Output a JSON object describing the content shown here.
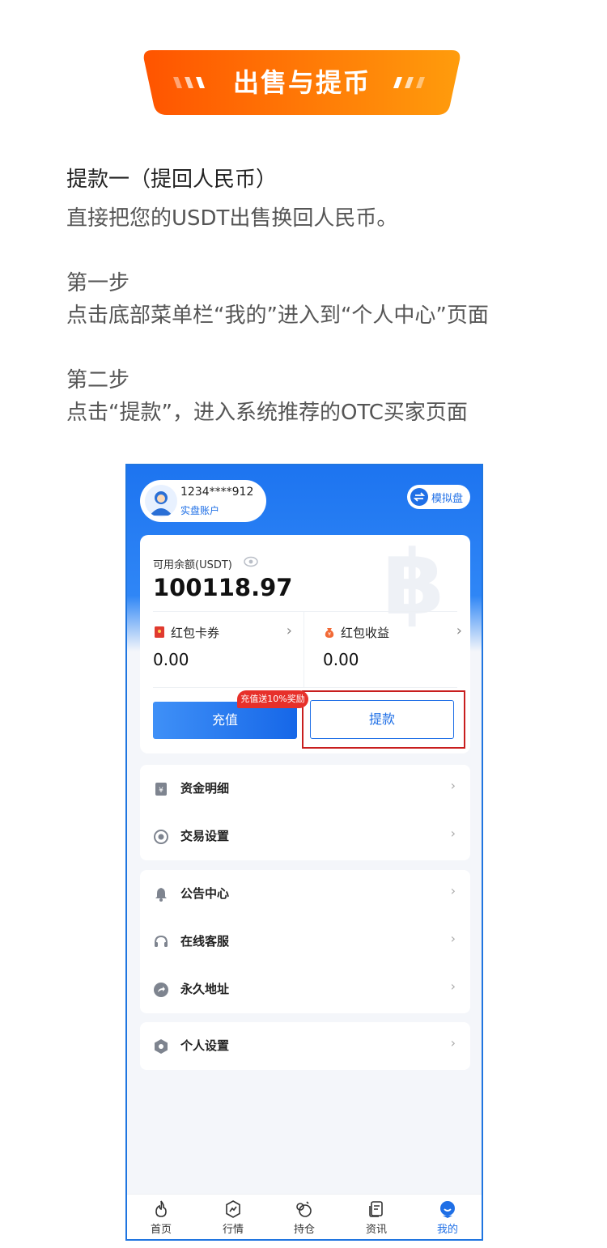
{
  "banner": {
    "title": "出售与提币"
  },
  "guide": {
    "heading": "提款一（提回人民币）",
    "intro": "直接把您的USDT出售换回人民币。",
    "step1_title": "第一步",
    "step1_text": "点击底部菜单栏“我的”进入到“个人中心”页面",
    "step2_title": "第二步",
    "step2_text": "点击“提款”，进入系统推荐的OTC买家页面"
  },
  "phone": {
    "user": {
      "id": "1234****912",
      "account_type": "实盘账户"
    },
    "simulate": {
      "label": "模拟盘"
    },
    "balance": {
      "label": "可用余额(USDT)",
      "value": "100118.97"
    },
    "coupons": {
      "label": "红包卡券",
      "value": "0.00"
    },
    "earnings": {
      "label": "红包收益",
      "value": "0.00"
    },
    "recharge": {
      "label": "充值",
      "promo": "充值送10%奖励"
    },
    "withdraw": {
      "label": "提款"
    },
    "menu_group_1": [
      {
        "label": "资金明细",
        "icon": "fund-detail-icon"
      },
      {
        "label": "交易设置",
        "icon": "trade-settings-icon"
      }
    ],
    "menu_group_2": [
      {
        "label": "公告中心",
        "icon": "bell-icon"
      },
      {
        "label": "在线客服",
        "icon": "headset-icon"
      },
      {
        "label": "永久地址",
        "icon": "share-arrow-icon"
      }
    ],
    "menu_group_3": [
      {
        "label": "个人设置",
        "icon": "hexagon-settings-icon"
      }
    ],
    "tabbar": [
      {
        "label": "首页",
        "icon": "flame-icon"
      },
      {
        "label": "行情",
        "icon": "market-icon"
      },
      {
        "label": "持仓",
        "icon": "position-icon"
      },
      {
        "label": "资讯",
        "icon": "news-icon"
      },
      {
        "label": "我的",
        "icon": "profile-icon",
        "active": true
      }
    ],
    "chevron": "›"
  },
  "colors": {
    "brand_blue": "#1f6fe6",
    "banner_gradient_start": "#ff5a00",
    "banner_gradient_end": "#ff9a0a",
    "highlight_red": "#c81e1e",
    "promo_red": "#e7302a"
  }
}
